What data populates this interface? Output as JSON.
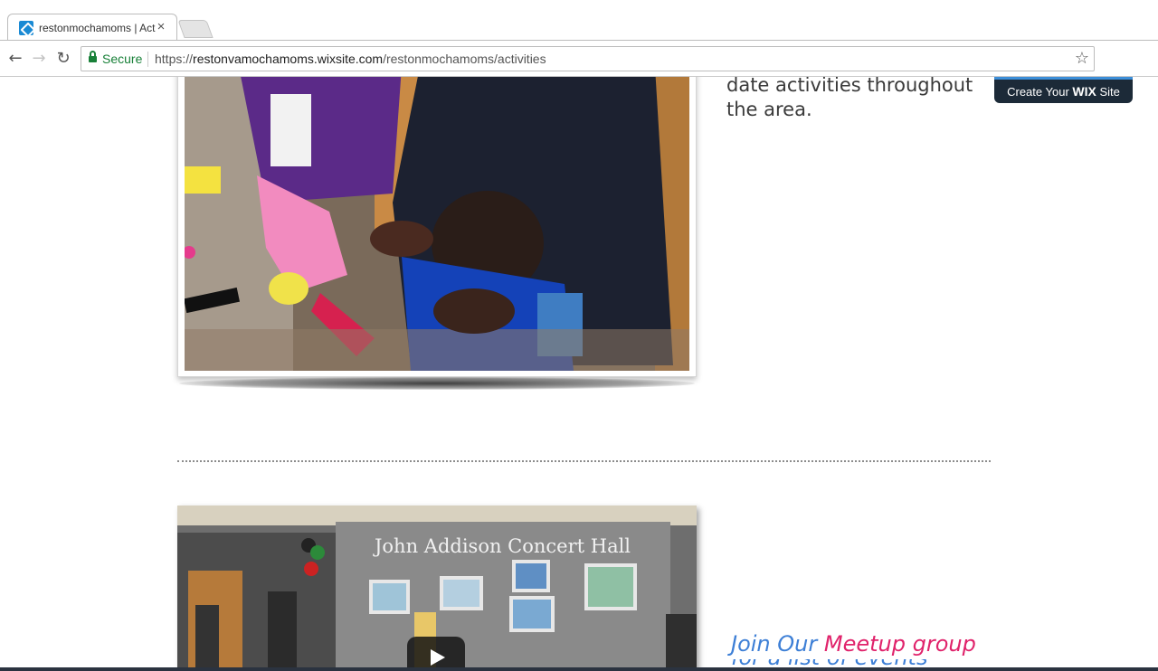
{
  "browser": {
    "tab_title": "restonmochamoms | Act",
    "tab_close": "×",
    "secure_label": "Secure",
    "url_scheme": "https://",
    "url_host": "restonvamochamoms.wixsite.com",
    "url_path": "/restonmochamoms/activities",
    "icons": [
      "back-arrow-icon",
      "forward-arrow-icon",
      "reload-icon",
      "lock-icon",
      "star-icon",
      "close-icon"
    ]
  },
  "content": {
    "text_line1": "date activities throughout",
    "text_line2": "the area.",
    "wix_badge_prefix": "Create Your",
    "wix_badge_brand": "WIX",
    "wix_badge_suffix": "Site",
    "video_sign": "John Addison Concert Hall",
    "meetup_part1": "Join Our",
    "meetup_part2": "Meetup group",
    "meetup_line2": "for a list of events"
  },
  "colors": {
    "secure_green": "#188038",
    "wix_badge_bg": "#1c2a38",
    "meetup_blue": "#3d7fd6",
    "meetup_pink": "#e0236b"
  }
}
